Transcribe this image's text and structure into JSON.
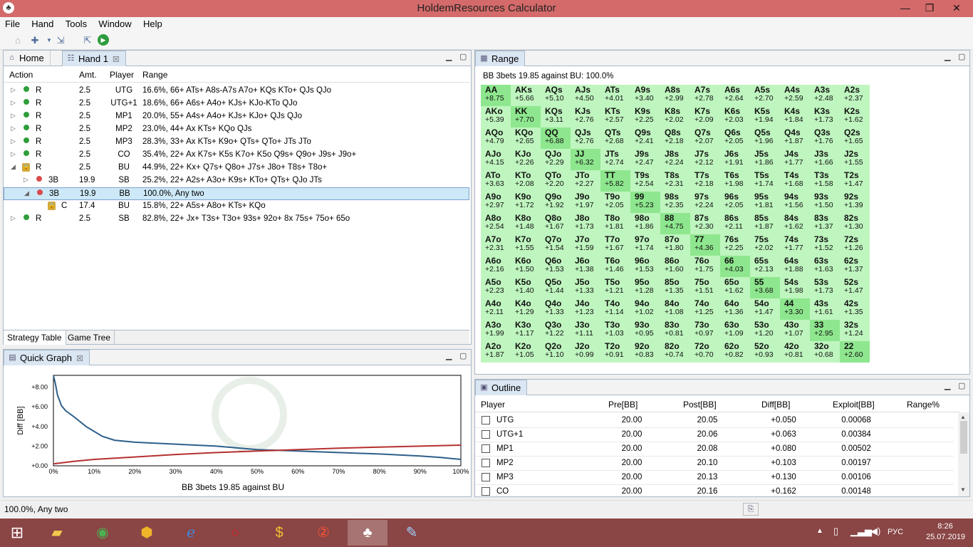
{
  "window": {
    "title": "HoldemResources Calculator"
  },
  "menu": [
    "File",
    "Hand",
    "Tools",
    "Window",
    "Help"
  ],
  "left_panel": {
    "tabs": [
      "Home",
      "Hand 1"
    ],
    "headers": [
      "Action",
      "Amt.",
      "Player",
      "Range"
    ],
    "rows": [
      {
        "action": "R",
        "amt": "2.5",
        "player": "UTG",
        "range": "16.6%, 66+ ATs+ A8s-A7s A7o+ KQs KTo+ QJs QJo"
      },
      {
        "action": "R",
        "amt": "2.5",
        "player": "UTG+1",
        "range": "18.6%, 66+ A6s+ A4o+ KJs+ KJo-KTo QJo"
      },
      {
        "action": "R",
        "amt": "2.5",
        "player": "MP1",
        "range": "20.0%, 55+ A4s+ A4o+ KJs+ KJo+ QJs QJo"
      },
      {
        "action": "R",
        "amt": "2.5",
        "player": "MP2",
        "range": "23.0%, 44+ Ax KTs+ KQo QJs"
      },
      {
        "action": "R",
        "amt": "2.5",
        "player": "MP3",
        "range": "28.3%, 33+ Ax KTs+ K9o+ QTs+ QTo+ JTs JTo"
      },
      {
        "action": "R",
        "amt": "2.5",
        "player": "CO",
        "range": "35.4%, 22+ Ax K7s+ K5s K7o+ K5o Q9s+ Q9o+ J9s+ J9o+"
      },
      {
        "action": "R",
        "amt": "2.5",
        "player": "BU",
        "range": "44.9%, 22+ Kx+ Q7s+ Q8o+ J7s+ J8o+ T8s+ T8o+"
      },
      {
        "action": "3B",
        "amt": "19.9",
        "player": "SB",
        "range": "25.2%, 22+ A2s+ A3o+ K9s+ KTo+ QTs+ QJo JTs"
      },
      {
        "action": "3B",
        "amt": "19.9",
        "player": "BB",
        "range": "100.0%, Any two"
      },
      {
        "action": "C",
        "amt": "17.4",
        "player": "BU",
        "range": "15.8%, 22+ A5s+ A8o+ KTs+ KQo"
      },
      {
        "action": "R",
        "amt": "2.5",
        "player": "SB",
        "range": "82.8%, 22+ Jx+ T3s+ T3o+ 93s+ 92o+ 8x 75s+ 75o+ 65o"
      }
    ],
    "bottom_tabs": [
      "Strategy Table",
      "Game Tree"
    ]
  },
  "quick_graph": {
    "tab": "Quick Graph",
    "caption": "BB 3bets  19.85 against BU"
  },
  "chart_data": {
    "type": "line",
    "xlabel": "",
    "ylabel": "Diff [BB]",
    "x_ticks": [
      "0%",
      "10%",
      "20%",
      "30%",
      "40%",
      "50%",
      "60%",
      "70%",
      "80%",
      "90%",
      "100%"
    ],
    "y_ticks": [
      "+0.00",
      "+2.00",
      "+4.00",
      "+6.00",
      "+8.00"
    ],
    "ylim": [
      0,
      9.2
    ],
    "xlim": [
      0,
      100
    ],
    "series": [
      {
        "color": "#2e5f8a",
        "x": [
          0,
          0.5,
          1,
          2,
          3,
          5,
          8,
          12,
          15,
          20,
          30,
          40,
          50,
          60,
          70,
          80,
          90,
          95,
          100
        ],
        "y": [
          9.2,
          8.3,
          7.2,
          6.1,
          5.6,
          5.0,
          4.0,
          3.0,
          2.6,
          2.4,
          2.2,
          2.0,
          1.65,
          1.5,
          1.35,
          1.2,
          1.0,
          0.85,
          0.65
        ]
      },
      {
        "color": "#b53030",
        "x": [
          0,
          5,
          10,
          20,
          30,
          40,
          50,
          60,
          70,
          80,
          90,
          100
        ],
        "y": [
          0.2,
          0.45,
          0.65,
          0.9,
          1.15,
          1.35,
          1.5,
          1.65,
          1.8,
          1.9,
          2.0,
          2.1
        ]
      }
    ]
  },
  "range_panel": {
    "tab": "Range",
    "caption": "BB 3bets 19.85 against BU: 100.0%",
    "grid": [
      [
        [
          "AA",
          "+8.75"
        ],
        [
          "AKs",
          "+5.66"
        ],
        [
          "AQs",
          "+5.10"
        ],
        [
          "AJs",
          "+4.50"
        ],
        [
          "ATs",
          "+4.01"
        ],
        [
          "A9s",
          "+3.40"
        ],
        [
          "A8s",
          "+2.99"
        ],
        [
          "A7s",
          "+2.78"
        ],
        [
          "A6s",
          "+2.64"
        ],
        [
          "A5s",
          "+2.70"
        ],
        [
          "A4s",
          "+2.59"
        ],
        [
          "A3s",
          "+2.48"
        ],
        [
          "A2s",
          "+2.37"
        ]
      ],
      [
        [
          "AKo",
          "+5.39"
        ],
        [
          "KK",
          "+7.70"
        ],
        [
          "KQs",
          "+3.11"
        ],
        [
          "KJs",
          "+2.76"
        ],
        [
          "KTs",
          "+2.57"
        ],
        [
          "K9s",
          "+2.25"
        ],
        [
          "K8s",
          "+2.02"
        ],
        [
          "K7s",
          "+2.09"
        ],
        [
          "K6s",
          "+2.03"
        ],
        [
          "K5s",
          "+1.94"
        ],
        [
          "K4s",
          "+1.84"
        ],
        [
          "K3s",
          "+1.73"
        ],
        [
          "K2s",
          "+1.62"
        ]
      ],
      [
        [
          "AQo",
          "+4.79"
        ],
        [
          "KQo",
          "+2.65"
        ],
        [
          "QQ",
          "+6.88"
        ],
        [
          "QJs",
          "+2.76"
        ],
        [
          "QTs",
          "+2.68"
        ],
        [
          "Q9s",
          "+2.41"
        ],
        [
          "Q8s",
          "+2.18"
        ],
        [
          "Q7s",
          "+2.07"
        ],
        [
          "Q6s",
          "+2.05"
        ],
        [
          "Q5s",
          "+1.96"
        ],
        [
          "Q4s",
          "+1.87"
        ],
        [
          "Q3s",
          "+1.76"
        ],
        [
          "Q2s",
          "+1.65"
        ]
      ],
      [
        [
          "AJo",
          "+4.15"
        ],
        [
          "KJo",
          "+2.26"
        ],
        [
          "QJo",
          "+2.29"
        ],
        [
          "JJ",
          "+6.32"
        ],
        [
          "JTs",
          "+2.74"
        ],
        [
          "J9s",
          "+2.47"
        ],
        [
          "J8s",
          "+2.24"
        ],
        [
          "J7s",
          "+2.12"
        ],
        [
          "J6s",
          "+1.91"
        ],
        [
          "J5s",
          "+1.86"
        ],
        [
          "J4s",
          "+1.77"
        ],
        [
          "J3s",
          "+1.66"
        ],
        [
          "J2s",
          "+1.55"
        ]
      ],
      [
        [
          "ATo",
          "+3.63"
        ],
        [
          "KTo",
          "+2.08"
        ],
        [
          "QTo",
          "+2.20"
        ],
        [
          "JTo",
          "+2.27"
        ],
        [
          "TT",
          "+5.82"
        ],
        [
          "T9s",
          "+2.54"
        ],
        [
          "T8s",
          "+2.31"
        ],
        [
          "T7s",
          "+2.18"
        ],
        [
          "T6s",
          "+1.98"
        ],
        [
          "T5s",
          "+1.74"
        ],
        [
          "T4s",
          "+1.68"
        ],
        [
          "T3s",
          "+1.58"
        ],
        [
          "T2s",
          "+1.47"
        ]
      ],
      [
        [
          "A9o",
          "+2.97"
        ],
        [
          "K9o",
          "+1.72"
        ],
        [
          "Q9o",
          "+1.92"
        ],
        [
          "J9o",
          "+1.97"
        ],
        [
          "T9o",
          "+2.05"
        ],
        [
          "99",
          "+5.23"
        ],
        [
          "98s",
          "+2.35"
        ],
        [
          "97s",
          "+2.24"
        ],
        [
          "96s",
          "+2.05"
        ],
        [
          "95s",
          "+1.81"
        ],
        [
          "94s",
          "+1.56"
        ],
        [
          "93s",
          "+1.50"
        ],
        [
          "92s",
          "+1.39"
        ]
      ],
      [
        [
          "A8o",
          "+2.54"
        ],
        [
          "K8o",
          "+1.48"
        ],
        [
          "Q8o",
          "+1.67"
        ],
        [
          "J8o",
          "+1.73"
        ],
        [
          "T8o",
          "+1.81"
        ],
        [
          "98o",
          "+1.86"
        ],
        [
          "88",
          "+4.75"
        ],
        [
          "87s",
          "+2.30"
        ],
        [
          "86s",
          "+2.11"
        ],
        [
          "85s",
          "+1.87"
        ],
        [
          "84s",
          "+1.62"
        ],
        [
          "83s",
          "+1.37"
        ],
        [
          "82s",
          "+1.30"
        ]
      ],
      [
        [
          "A7o",
          "+2.31"
        ],
        [
          "K7o",
          "+1.55"
        ],
        [
          "Q7o",
          "+1.54"
        ],
        [
          "J7o",
          "+1.59"
        ],
        [
          "T7o",
          "+1.67"
        ],
        [
          "97o",
          "+1.74"
        ],
        [
          "87o",
          "+1.80"
        ],
        [
          "77",
          "+4.36"
        ],
        [
          "76s",
          "+2.25"
        ],
        [
          "75s",
          "+2.02"
        ],
        [
          "74s",
          "+1.77"
        ],
        [
          "73s",
          "+1.52"
        ],
        [
          "72s",
          "+1.26"
        ]
      ],
      [
        [
          "A6o",
          "+2.16"
        ],
        [
          "K6o",
          "+1.50"
        ],
        [
          "Q6o",
          "+1.53"
        ],
        [
          "J6o",
          "+1.38"
        ],
        [
          "T6o",
          "+1.46"
        ],
        [
          "96o",
          "+1.53"
        ],
        [
          "86o",
          "+1.60"
        ],
        [
          "76o",
          "+1.75"
        ],
        [
          "66",
          "+4.03"
        ],
        [
          "65s",
          "+2.13"
        ],
        [
          "64s",
          "+1.88"
        ],
        [
          "63s",
          "+1.63"
        ],
        [
          "62s",
          "+1.37"
        ]
      ],
      [
        [
          "A5o",
          "+2.23"
        ],
        [
          "K5o",
          "+1.40"
        ],
        [
          "Q5o",
          "+1.44"
        ],
        [
          "J5o",
          "+1.33"
        ],
        [
          "T5o",
          "+1.21"
        ],
        [
          "95o",
          "+1.28"
        ],
        [
          "85o",
          "+1.35"
        ],
        [
          "75o",
          "+1.51"
        ],
        [
          "65o",
          "+1.62"
        ],
        [
          "55",
          "+3.68"
        ],
        [
          "54s",
          "+1.98"
        ],
        [
          "53s",
          "+1.73"
        ],
        [
          "52s",
          "+1.47"
        ]
      ],
      [
        [
          "A4o",
          "+2.11"
        ],
        [
          "K4o",
          "+1.29"
        ],
        [
          "Q4o",
          "+1.33"
        ],
        [
          "J4o",
          "+1.23"
        ],
        [
          "T4o",
          "+1.14"
        ],
        [
          "94o",
          "+1.02"
        ],
        [
          "84o",
          "+1.08"
        ],
        [
          "74o",
          "+1.25"
        ],
        [
          "64o",
          "+1.36"
        ],
        [
          "54o",
          "+1.47"
        ],
        [
          "44",
          "+3.30"
        ],
        [
          "43s",
          "+1.61"
        ],
        [
          "42s",
          "+1.35"
        ]
      ],
      [
        [
          "A3o",
          "+1.99"
        ],
        [
          "K3o",
          "+1.17"
        ],
        [
          "Q3o",
          "+1.22"
        ],
        [
          "J3o",
          "+1.11"
        ],
        [
          "T3o",
          "+1.03"
        ],
        [
          "93o",
          "+0.95"
        ],
        [
          "83o",
          "+0.81"
        ],
        [
          "73o",
          "+0.97"
        ],
        [
          "63o",
          "+1.09"
        ],
        [
          "53o",
          "+1.20"
        ],
        [
          "43o",
          "+1.07"
        ],
        [
          "33",
          "+2.95"
        ],
        [
          "32s",
          "+1.24"
        ]
      ],
      [
        [
          "A2o",
          "+1.87"
        ],
        [
          "K2o",
          "+1.05"
        ],
        [
          "Q2o",
          "+1.10"
        ],
        [
          "J2o",
          "+0.99"
        ],
        [
          "T2o",
          "+0.91"
        ],
        [
          "92o",
          "+0.83"
        ],
        [
          "82o",
          "+0.74"
        ],
        [
          "72o",
          "+0.70"
        ],
        [
          "62o",
          "+0.82"
        ],
        [
          "52o",
          "+0.93"
        ],
        [
          "42o",
          "+0.81"
        ],
        [
          "32o",
          "+0.68"
        ],
        [
          "22",
          "+2.60"
        ]
      ]
    ]
  },
  "outline": {
    "tab": "Outline",
    "headers": [
      "Player",
      "Pre[BB]",
      "Post[BB]",
      "Diff[BB]",
      "Exploit[BB]",
      "Range%"
    ],
    "rows": [
      [
        "UTG",
        "20.00",
        "20.05",
        "+0.050",
        "0.00068"
      ],
      [
        "UTG+1",
        "20.00",
        "20.06",
        "+0.063",
        "0.00384"
      ],
      [
        "MP1",
        "20.00",
        "20.08",
        "+0.080",
        "0.00502"
      ],
      [
        "MP2",
        "20.00",
        "20.10",
        "+0.103",
        "0.00197"
      ],
      [
        "MP3",
        "20.00",
        "20.13",
        "+0.130",
        "0.00106"
      ],
      [
        "CO",
        "20.00",
        "20.16",
        "+0.162",
        "0.00148"
      ]
    ]
  },
  "status": {
    "text": "100.0%, Any two"
  },
  "taskbar": {
    "lang": "РУС",
    "time": "8:26",
    "date": "25.07.2019"
  }
}
